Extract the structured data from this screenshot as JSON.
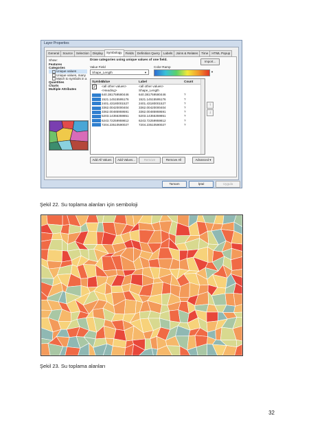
{
  "dialog": {
    "title": "Layer Properties",
    "tabs": [
      {
        "label": "General"
      },
      {
        "label": "Source"
      },
      {
        "label": "Selection"
      },
      {
        "label": "Display"
      },
      {
        "label": "Symbology",
        "active": true
      },
      {
        "label": "Fields"
      },
      {
        "label": "Definition Query"
      },
      {
        "label": "Labels"
      },
      {
        "label": "Joins & Relates"
      },
      {
        "label": "Time"
      },
      {
        "label": "HTML Popup"
      }
    ],
    "show_label": "Show:",
    "tree": [
      {
        "label": "Features",
        "bold": true
      },
      {
        "label": "Categories",
        "bold": true
      },
      {
        "label": "Unique values",
        "sub": true,
        "selected": true
      },
      {
        "label": "Unique values, many",
        "sub": true
      },
      {
        "label": "Match to symbols in a",
        "sub": true
      },
      {
        "label": "Quantities",
        "bold": true
      },
      {
        "label": "Charts",
        "bold": true
      },
      {
        "label": "Multiple Attributes",
        "bold": true
      }
    ],
    "description": "Draw categories using unique values of one field.",
    "import_label": "Import...",
    "value_field_label": "Value Field",
    "value_field_value": "Shape_Length",
    "color_ramp_label": "Color Ramp",
    "table": {
      "headers": {
        "symbol": "Symbol",
        "value": "Value",
        "label": "Label",
        "count": "Count"
      },
      "rows": [
        {
          "value": "<all other values>",
          "label": "<all other values>",
          "count": "",
          "kind": "check"
        },
        {
          "value": "<Heading>",
          "label": "Shape_Length",
          "count": "",
          "kind": "heading"
        },
        {
          "value": "640.381759580446",
          "label": "640.381759580446",
          "count": "?",
          "kind": "swatch"
        },
        {
          "value": "1521.14515595176",
          "label": "1521.14515595176",
          "count": "?",
          "kind": "swatch"
        },
        {
          "value": "2401.43180001527",
          "label": "2401.43180001527",
          "count": "?",
          "kind": "swatch"
        },
        {
          "value": "3362.00420000404",
          "label": "3362.00420000404",
          "count": "?",
          "kind": "swatch"
        },
        {
          "value": "3362.00485959591",
          "label": "3362.00485959591",
          "count": "?",
          "kind": "swatch"
        },
        {
          "value": "5203.14355359851",
          "label": "5203.14355359851",
          "count": "?",
          "kind": "swatch"
        },
        {
          "value": "6243.72259959812",
          "label": "6243.72259959812",
          "count": "?",
          "kind": "swatch"
        },
        {
          "value": "7204.23510590027",
          "label": "7204.23510590027",
          "count": "?",
          "kind": "swatch"
        }
      ]
    },
    "buttons": {
      "add_all": "Add All Values",
      "add_values": "Add Values...",
      "remove": "Remove",
      "remove_all": "Remove All",
      "advanced": "Advanced"
    },
    "footer": {
      "ok": "Tamam",
      "cancel": "İptal",
      "apply": "Uygula"
    }
  },
  "caption1": "Şekil 22. Su toplama alanları için semboloji",
  "caption2": "Şekil 23. Su toplama alanları",
  "page_number": "32",
  "colors": {
    "map_palette": [
      "#e8473a",
      "#f06a45",
      "#f39a5a",
      "#f6b86a",
      "#f7d27a",
      "#d8d98f",
      "#a9c7a4",
      "#8fb8b3"
    ],
    "dialog_frame": "#cfdcec",
    "swatch": "#2f7fcf"
  }
}
